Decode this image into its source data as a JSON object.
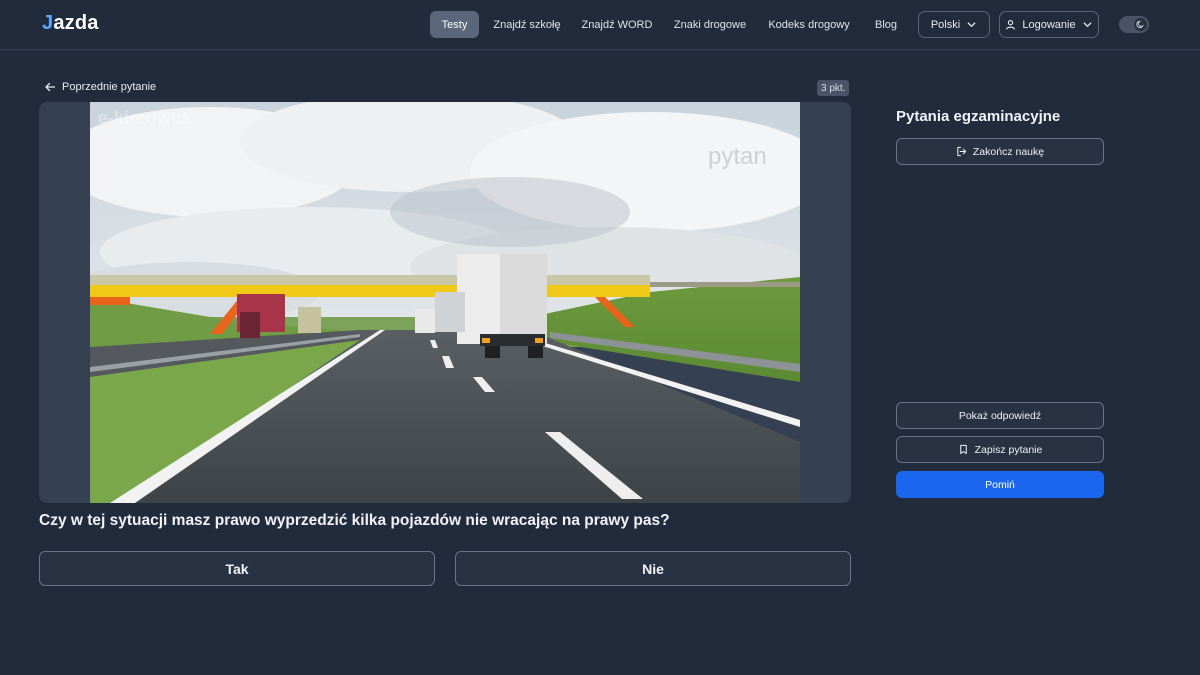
{
  "header": {
    "logo_j": "J",
    "logo_rest": "azda",
    "nav": [
      {
        "label": "Testy",
        "active": true
      },
      {
        "label": "Znajdź szkołę"
      },
      {
        "label": "Znajdź WORD"
      },
      {
        "label": "Znaki drogowe"
      },
      {
        "label": "Kodeks drogowy"
      },
      {
        "label": "Blog"
      }
    ],
    "language": "Polski",
    "login": "Logowanie"
  },
  "question_view": {
    "back_label": "Poprzednie pytanie",
    "points": "3 pkt.",
    "watermark_top_left": "e-kierowca",
    "watermark_top_right": "pytan",
    "question": "Czy w tej sytuacji masz prawo wyprzedzić kilka pojazdów nie wracając na prawy pas?",
    "answers": [
      "Tak",
      "Nie"
    ]
  },
  "sidebar": {
    "title": "Pytania egzaminacyjne",
    "finish_label": "Zakończ naukę",
    "show_answer_label": "Pokaż odpowiedź",
    "save_label": "Zapisz pytanie",
    "skip_label": "Pomiń"
  },
  "colors": {
    "background": "#222b3b",
    "primary": "#1a66ee",
    "active_nav": "#5a6679"
  }
}
